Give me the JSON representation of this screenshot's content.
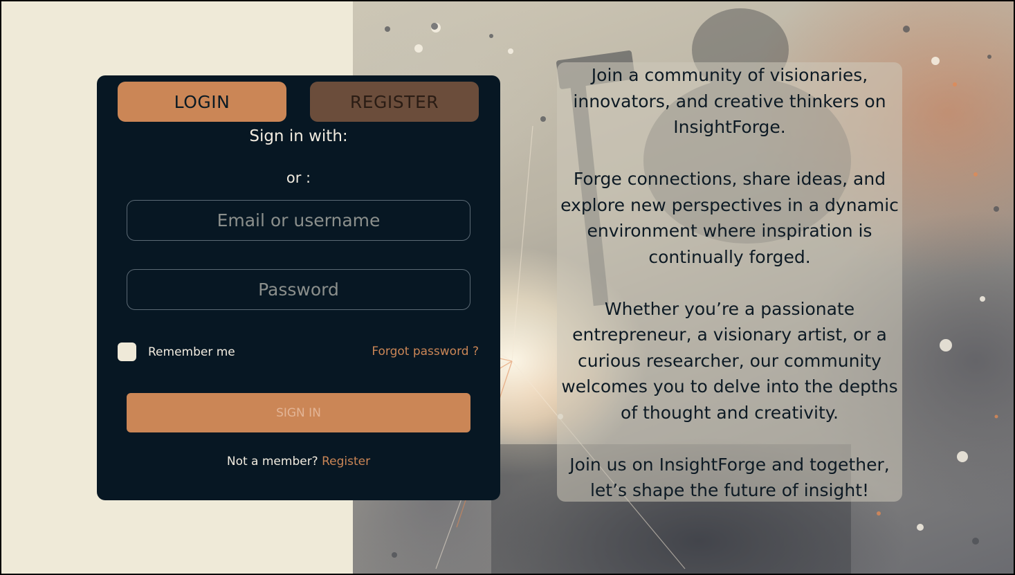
{
  "auth": {
    "tabs": {
      "login": "LOGIN",
      "register": "REGISTER"
    },
    "sign_in_with": "Sign in with:",
    "or": "or :",
    "email_placeholder": "Email or username",
    "password_placeholder": "Password",
    "remember_me": "Remember me",
    "forgot_password": "Forgot password ?",
    "sign_in_button": "SIGN IN",
    "not_member": "Not a member? ",
    "register_link": "Register"
  },
  "info": {
    "paragraphs": [
      "Join a community of visionaries, innovators, and creative thinkers on InsightForge.",
      "Forge connections, share ideas, and explore new perspectives in a dynamic environment where inspiration is continually forged.",
      "Whether you’re a passionate entrepreneur, a visionary artist, or a curious researcher, our community welcomes you to delve into the depths of thought and creativity.",
      "Join us on InsightForge and together, let’s shape the future of insight!"
    ]
  },
  "colors": {
    "page_bg": "#efead8",
    "card_bg": "#071723",
    "accent": "#cb8656",
    "register_tab": "#6b4d3b"
  }
}
